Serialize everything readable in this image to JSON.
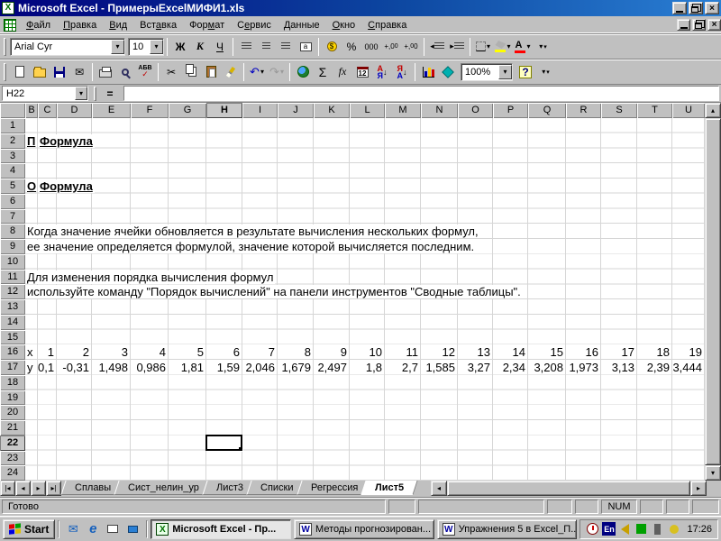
{
  "window": {
    "title": "Microsoft Excel - ПримерыExcelМИФИ1.xls"
  },
  "menu": {
    "items": [
      {
        "label": "Файл",
        "key": 0
      },
      {
        "label": "Правка",
        "key": 0
      },
      {
        "label": "Вид",
        "key": 0
      },
      {
        "label": "Вставка",
        "key": 3
      },
      {
        "label": "Формат",
        "key": 3
      },
      {
        "label": "Сервис",
        "key": 1
      },
      {
        "label": "Данные",
        "key": 0
      },
      {
        "label": "Окно",
        "key": 0
      },
      {
        "label": "Справка",
        "key": 0
      }
    ]
  },
  "formatting_toolbar": {
    "font_name": "Arial Cyr",
    "font_size": "10",
    "bold": "Ж",
    "italic": "К",
    "underline": "Ч",
    "percent": "%",
    "thousands": "000",
    "merge": "a",
    "font_color_letter": "А",
    "accent_fill": "#ffff00",
    "accent_font": "#ff0000"
  },
  "standard_toolbar": {
    "autosum": "Σ",
    "function": "fx",
    "calendar": "12",
    "sort_az_top": "А",
    "sort_az_bottom": "Я",
    "sort_arrow": "↓",
    "spelling_top": "АБВ",
    "spelling_check": "✓",
    "zoom": "100%",
    "help": "?",
    "undo": "↶",
    "redo": "↷",
    "cut": "✂",
    "mail": "✉"
  },
  "formula_bar": {
    "name_box": "H22",
    "equals": "="
  },
  "grid": {
    "columns": [
      "B",
      "C",
      "D",
      "E",
      "F",
      "G",
      "H",
      "I",
      "J",
      "K",
      "L",
      "M",
      "N",
      "O",
      "P",
      "Q",
      "R",
      "S",
      "T",
      "U"
    ],
    "active_column": "H",
    "row_count": 24,
    "active_row": 22,
    "selection": "H22",
    "text_cells": [
      {
        "row": 2,
        "col": "B",
        "text": "П",
        "bold": true,
        "underline": true,
        "clip": true
      },
      {
        "row": 2,
        "col": "C",
        "text": "Формула",
        "bold": true,
        "underline": true
      },
      {
        "row": 5,
        "col": "B",
        "text": "О",
        "bold": true,
        "underline": true,
        "clip": true
      },
      {
        "row": 5,
        "col": "C",
        "text": "Формула",
        "bold": true,
        "underline": true
      },
      {
        "row": 8,
        "col": "B",
        "text": "Когда значение ячейки обновляется в результате вычисления нескольких формул,"
      },
      {
        "row": 9,
        "col": "B",
        "text": "ее значение определяется формулой, значение которой вычисляется последним."
      },
      {
        "row": 11,
        "col": "B",
        "text": "Для изменения порядка вычисления формул"
      },
      {
        "row": 12,
        "col": "B",
        "text": "используйте команду \"Порядок вычислений\" на панели инструментов \"Сводные таблицы\"."
      }
    ],
    "series_rows": [
      {
        "row": 16,
        "label": "x",
        "values": [
          "1",
          "2",
          "3",
          "4",
          "5",
          "6",
          "7",
          "8",
          "9",
          "10",
          "11",
          "12",
          "13",
          "14",
          "15",
          "16",
          "17",
          "18",
          "19"
        ]
      },
      {
        "row": 17,
        "label": "y",
        "values": [
          "0,1",
          "-0,31",
          "1,498",
          "0,986",
          "1,81",
          "1,59",
          "2,046",
          "1,679",
          "2,497",
          "1,8",
          "2,7",
          "1,585",
          "3,27",
          "2,34",
          "3,208",
          "1,973",
          "3,13",
          "2,39",
          "3,444"
        ]
      }
    ]
  },
  "sheet_tabs": {
    "tabs": [
      "Сплавы",
      "Сист_нелин_ур",
      "Лист3",
      "Списки",
      "Регрессия",
      "Лист5"
    ],
    "active": "Лист5"
  },
  "status_bar": {
    "mode": "Готово",
    "num": "NUM"
  },
  "taskbar": {
    "start": "Start",
    "buttons": [
      {
        "app": "excel",
        "label": "Microsoft Excel - Пр...",
        "active": true
      },
      {
        "app": "word",
        "label": "Методы прогнозирован...",
        "active": false
      },
      {
        "app": "word",
        "label": "Упражнения 5 в Excel_П...",
        "active": false
      }
    ],
    "lang": "En",
    "time": "17:26"
  }
}
